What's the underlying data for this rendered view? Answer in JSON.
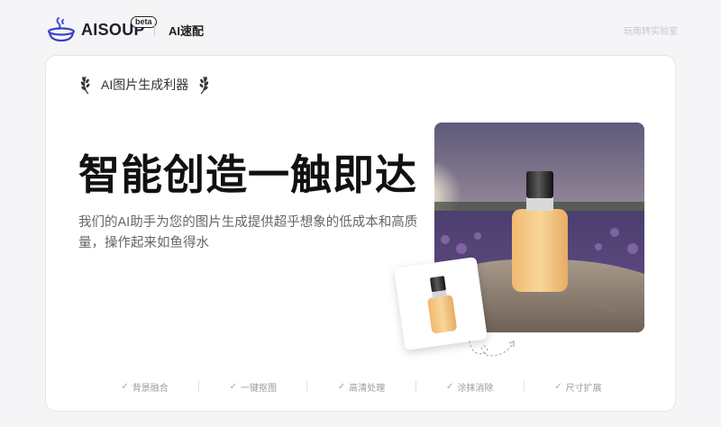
{
  "header": {
    "logo_text": "AISOUP",
    "beta_badge": "beta",
    "brand_sub": "AI速配",
    "top_link": "玩南转实验室"
  },
  "hero": {
    "tagline": "AI图片生成利器",
    "headline": "智能创造一触即达",
    "description": "我们的AI助手为您的图片生成提供超乎想象的低成本和高质量，操作起来如鱼得水"
  },
  "features": [
    {
      "label": "背景融合",
      "icon": "check-icon"
    },
    {
      "label": "一键抠图",
      "icon": "check-icon"
    },
    {
      "label": "高清处理",
      "icon": "check-icon"
    },
    {
      "label": "涂抹消除",
      "icon": "check-icon"
    },
    {
      "label": "尺寸扩展",
      "icon": "check-icon"
    }
  ],
  "colors": {
    "page_bg": "#f5f5f7",
    "card_bg": "#ffffff",
    "headline": "#111111",
    "muted": "#9a9aa0",
    "product": "#f5c98a"
  }
}
